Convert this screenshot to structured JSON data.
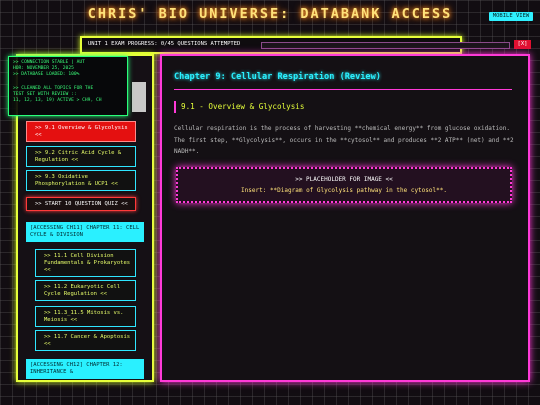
{
  "header": {
    "title": "CHRIS' BIO UNIVERSE: DATABANK ACCESS",
    "mobile_view_label": "MOBILE VIEW"
  },
  "progress": {
    "label": "UNIT 1 EXAM PROGRESS: 0/45 QUESTIONS ATTEMPTED",
    "fraction": 0,
    "close_label": "[X]"
  },
  "debug": {
    "lines": [
      ">> CONNECTION STABLE | AUT",
      "HOR: NOVEMBER 25, 2025",
      ">> DATABASE LOADED: 100%",
      "",
      ">> CLEANED ALL TOPICS FOR THE",
      "TEST SET WITH REVIEW ::",
      "11, 12, 13, 19) ACTIVE > CH9, CH"
    ]
  },
  "sidebar": {
    "items": [
      {
        "label": ">> 9.1 Overview & Glycolysis <<"
      },
      {
        "label": ">> 9.2 Citric Acid Cycle & Regulation <<"
      },
      {
        "label": ">> 9.3 Oxidative Phosphorylation & UCP1 <<"
      },
      {
        "label": ">> START 10 QUESTION QUIZ <<"
      }
    ],
    "chapter11": {
      "heading": "[ACCESSING CH11] CHAPTER 11: CELL CYCLE & DIVISION",
      "items": [
        {
          "label": ">> 11.1 Cell Division Fundamentals & Prokaryotes <<"
        },
        {
          "label": ">> 11.2 Eukaryotic Cell Cycle Regulation <<"
        },
        {
          "label": ">> 11.3_11.5 Mitosis vs. Meiosis <<"
        },
        {
          "label": ">> 11.7 Cancer & Apoptosis <<"
        }
      ]
    },
    "chapter12": {
      "heading": "[ACCESSING CH12] CHAPTER 12: INHERITANCE &"
    }
  },
  "main": {
    "chapter_title": "Chapter 9: Cellular Respiration (Review)",
    "section_heading": "9.1 - Overview & Glycolysis",
    "body": "Cellular respiration is the process of harvesting **chemical energy** from glucose oxidation. The first step, **Glycolysis**, occurs in the **cytosol** and produces **2 ATP** (net) and **2 NADH**.",
    "placeholder_title": ">> PLACEHOLDER FOR IMAGE <<",
    "placeholder_insert": "Insert: **Diagram of Glycolysis pathway in the cytosol**."
  },
  "colors": {
    "accent_cyan": "#2af0ff",
    "accent_magenta": "#ff3ad8",
    "accent_yellow": "#e6ff3a",
    "title_glow": "#ffe27a",
    "active_red": "#e41010"
  }
}
